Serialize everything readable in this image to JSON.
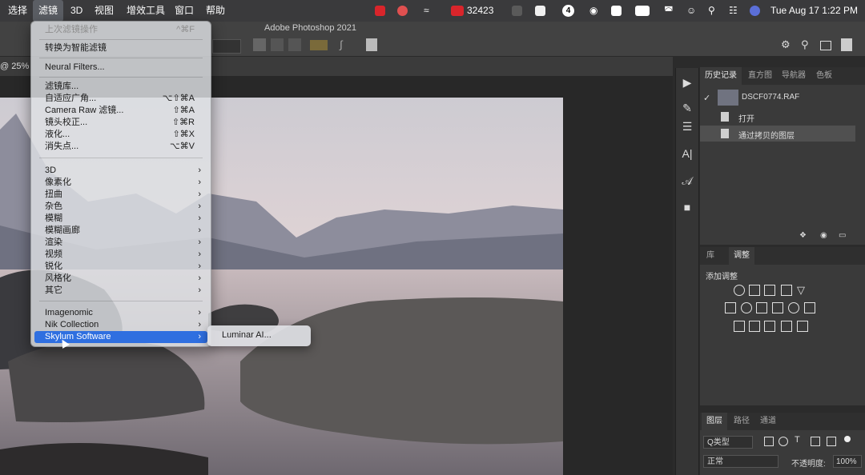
{
  "menubar": {
    "items": [
      "选择",
      "滤镜",
      "3D",
      "视图",
      "增效工具",
      "窗口",
      "帮助"
    ],
    "counter": "32423",
    "badge": "4",
    "datetime": "Tue Aug 17  1:22 PM"
  },
  "app_title": "Adobe Photoshop 2021",
  "doc_tab": "@ 25%",
  "filter_menu": {
    "last_filter": "上次滤镜操作",
    "last_filter_shortcut": "^⌘F",
    "smart": "转换为智能滤镜",
    "neural": "Neural Filters...",
    "gallery": "滤镜库...",
    "adaptive": "自适应广角...",
    "adaptive_shortcut": "⌥⇧⌘A",
    "camera_raw": "Camera Raw 滤镜...",
    "camera_raw_shortcut": "⇧⌘A",
    "lens": "镜头校正...",
    "lens_shortcut": "⇧⌘R",
    "liquify": "液化...",
    "liquify_shortcut": "⇧⌘X",
    "vanish": "消失点...",
    "vanish_shortcut": "⌥⌘V",
    "submenus": [
      "3D",
      "像素化",
      "扭曲",
      "杂色",
      "模糊",
      "模糊画廊",
      "渲染",
      "视频",
      "锐化",
      "风格化",
      "其它"
    ],
    "plugins": [
      "Imagenomic",
      "Nik Collection",
      "Skylum Software"
    ]
  },
  "submenu_item": "Luminar AI...",
  "history_panel": {
    "tabs": [
      "历史记录",
      "直方图",
      "导航器",
      "色板"
    ],
    "snapshot": "DSCF0774.RAF",
    "steps": [
      "打开",
      "通过拷贝的图层"
    ]
  },
  "adjust_panel": {
    "tabs": [
      "库",
      "调整"
    ],
    "title": "添加调整"
  },
  "layers_panel": {
    "tabs": [
      "图层",
      "路径",
      "通道"
    ],
    "filter": "Q类型",
    "blend": "正常",
    "opacity_label": "不透明度:",
    "opacity": "100%"
  }
}
